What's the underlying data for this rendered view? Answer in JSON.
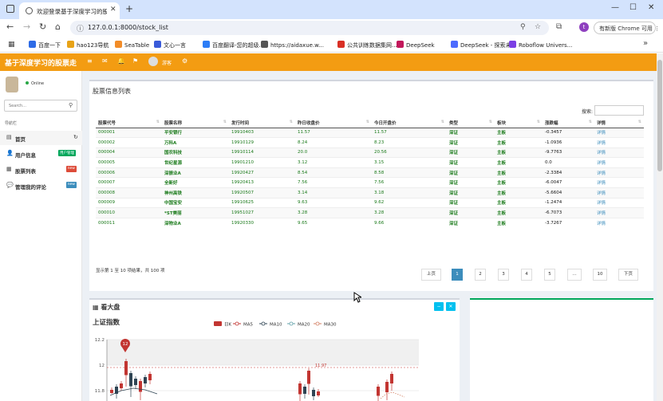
{
  "browser": {
    "tab_title": "欢迎登录基于深度学习的股票走",
    "url": "127.0.0.1:8000/stock_list",
    "profile_initial": "t",
    "update_label": "有新版 Chrome 可用",
    "bookmarks": [
      {
        "label": "百度一下",
        "color": "#2e6be6"
      },
      {
        "label": "hao123导航",
        "color": "#e8a317"
      },
      {
        "label": "SeaTable",
        "color": "#f28c28"
      },
      {
        "label": "文心一言",
        "color": "#3a5bd9"
      },
      {
        "label": "百度翻译-您的超级...",
        "color": "#2d7df6"
      },
      {
        "label": "https://aidaxue.w...",
        "color": "#555555"
      },
      {
        "label": "公共训练数据集网...",
        "color": "#d93025"
      },
      {
        "label": "DeepSeek",
        "color": "#c2185b"
      },
      {
        "label": "DeepSeek - 探索未...",
        "color": "#4d6bfe"
      },
      {
        "label": "Roboflow Univers...",
        "color": "#7b3fe4"
      }
    ]
  },
  "app": {
    "brand": "基于深度学习的股票走",
    "user_name": "游客",
    "accent": "#f39c12"
  },
  "sidebar": {
    "status": "Online",
    "search_placeholder": "Search...",
    "nav_header": "导航栏",
    "items": [
      {
        "label": "首页",
        "icon": "dashboard-icon"
      },
      {
        "label": "用户信息",
        "icon": "users-icon",
        "badge": "用户管理",
        "badge_color": "#00a65a"
      },
      {
        "label": "股票列表",
        "icon": "th-icon",
        "badge": "new",
        "badge_color": "#dd4b39"
      },
      {
        "label": "管理我的评论",
        "icon": "comment-icon",
        "badge": "new",
        "badge_color": "#3c8dbc"
      }
    ]
  },
  "stock_list": {
    "title": "股票信息列表",
    "search_label": "搜索:",
    "columns": [
      "股票代号",
      "股票名称",
      "发行时间",
      "昨日收盘价",
      "今日开盘价",
      "类型",
      "板块",
      "涨跌幅",
      "详情"
    ],
    "rows": [
      [
        "000001",
        "平安银行",
        "19910403",
        "11.57",
        "11.57",
        "深证",
        "主板",
        "-0.3457",
        "详情"
      ],
      [
        "000002",
        "万科A",
        "19910129",
        "8.24",
        "8.23",
        "深证",
        "主板",
        "-1.0936",
        "详情"
      ],
      [
        "000004",
        "国农科技",
        "19910114",
        "20.0",
        "20.56",
        "深证",
        "主板",
        "-9.7763",
        "详情"
      ],
      [
        "000005",
        "世纪星源",
        "19901210",
        "3.12",
        "3.15",
        "深证",
        "主板",
        "0.0",
        "详情"
      ],
      [
        "000006",
        "深振业A",
        "19920427",
        "8.54",
        "8.58",
        "深证",
        "主板",
        "-2.3384",
        "详情"
      ],
      [
        "000007",
        "全新好",
        "19920413",
        "7.56",
        "7.56",
        "深证",
        "主板",
        "-6.0047",
        "详情"
      ],
      [
        "000008",
        "神州高铁",
        "19920507",
        "3.14",
        "3.18",
        "深证",
        "主板",
        "-5.6604",
        "详情"
      ],
      [
        "000009",
        "中国宝安",
        "19910625",
        "9.63",
        "9.62",
        "深证",
        "主板",
        "-1.2474",
        "详情"
      ],
      [
        "000010",
        "*ST美丽",
        "19951027",
        "3.28",
        "3.28",
        "深证",
        "主板",
        "-6.7073",
        "详情"
      ],
      [
        "000011",
        "深物业A",
        "19920330",
        "9.65",
        "9.66",
        "深证",
        "主板",
        "-3.7267",
        "详情"
      ]
    ],
    "info": "显示第 1 至 10 项结果，共 100 项",
    "pagination": [
      "上页",
      "1",
      "2",
      "3",
      "4",
      "5",
      "…",
      "10",
      "下页"
    ],
    "active_page": "1"
  },
  "market": {
    "title": "看大盘",
    "index_title": "上证指数",
    "chart_data": {
      "type": "candlestick",
      "title": "上证指数",
      "legend": [
        "日K",
        "MA5",
        "MA10",
        "MA20",
        "MA30"
      ],
      "legend_colors": [
        "#c23531",
        "#c23531",
        "#2f4554",
        "#61a0a8",
        "#d48265"
      ],
      "y_ticks": [
        "12.2",
        "12",
        "11.8"
      ],
      "max_marker": "12",
      "mark_line_value": "11.97"
    }
  }
}
